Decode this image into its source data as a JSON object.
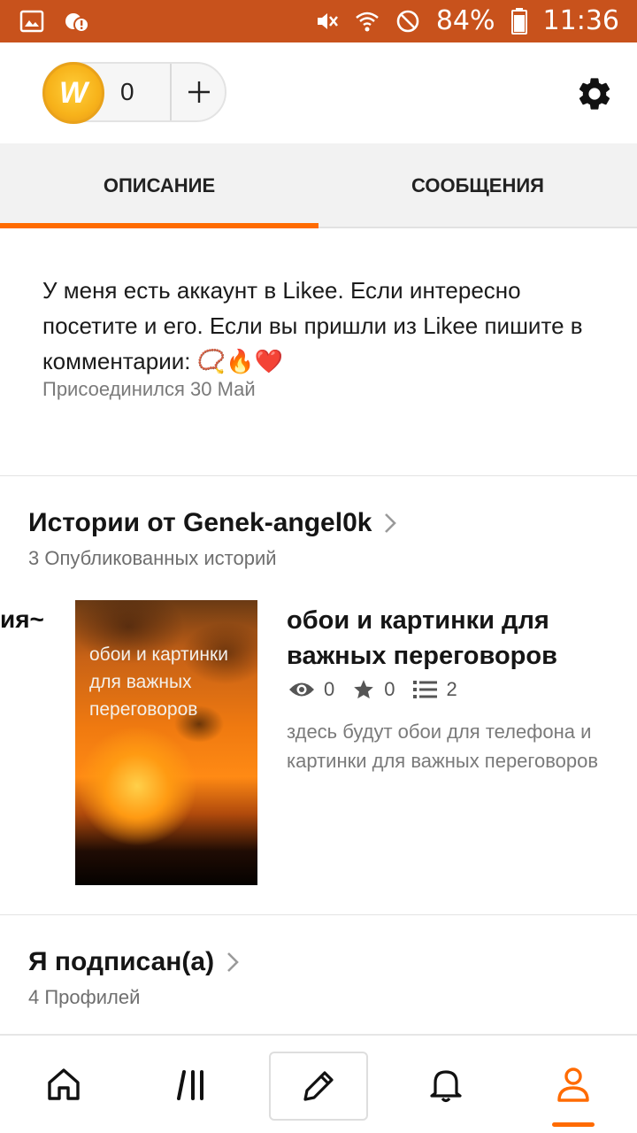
{
  "status_bar": {
    "battery": "84%",
    "time": "11:36",
    "icons": [
      "image-icon",
      "notification-alert-icon",
      "mute-icon",
      "wifi-icon",
      "do-not-disturb-icon",
      "battery-icon"
    ]
  },
  "header": {
    "coin_count": "0",
    "coin_symbol": "W",
    "add_icon": "plus-icon",
    "settings_icon": "gear-icon"
  },
  "tabs": [
    {
      "label": "ОПИСАНИЕ",
      "active": true
    },
    {
      "label": "СООБЩЕНИЯ",
      "active": false
    }
  ],
  "about": {
    "text": "У меня есть аккаунт в Likee. Если интересно посетите и его. Если вы пришли из Likee пишите в комментарии: 📿🔥❤️",
    "joined": "Присоединился 30 Май"
  },
  "stories": {
    "title": "Истории от Genek-angel0k",
    "subtitle": "3 Опубликованных историй",
    "prev_story_fragment": "ия~",
    "story": {
      "cover_text": "обои и картинки для важных переговоров",
      "title": "обои и картинки для важных переговоров",
      "views": "0",
      "votes": "0",
      "parts": "2",
      "description": "здесь будут обои для телефона и картинки для важных переговоров"
    }
  },
  "following": {
    "title": "Я подписан(а)",
    "subtitle": "4 Профилей"
  },
  "bottom_nav": {
    "items": [
      "home-icon",
      "browse-icon",
      "write-icon",
      "notifications-icon",
      "profile-icon"
    ],
    "active": "profile-icon"
  },
  "colors": {
    "status_bar": "#c8521c",
    "accent": "#ff6b00"
  }
}
